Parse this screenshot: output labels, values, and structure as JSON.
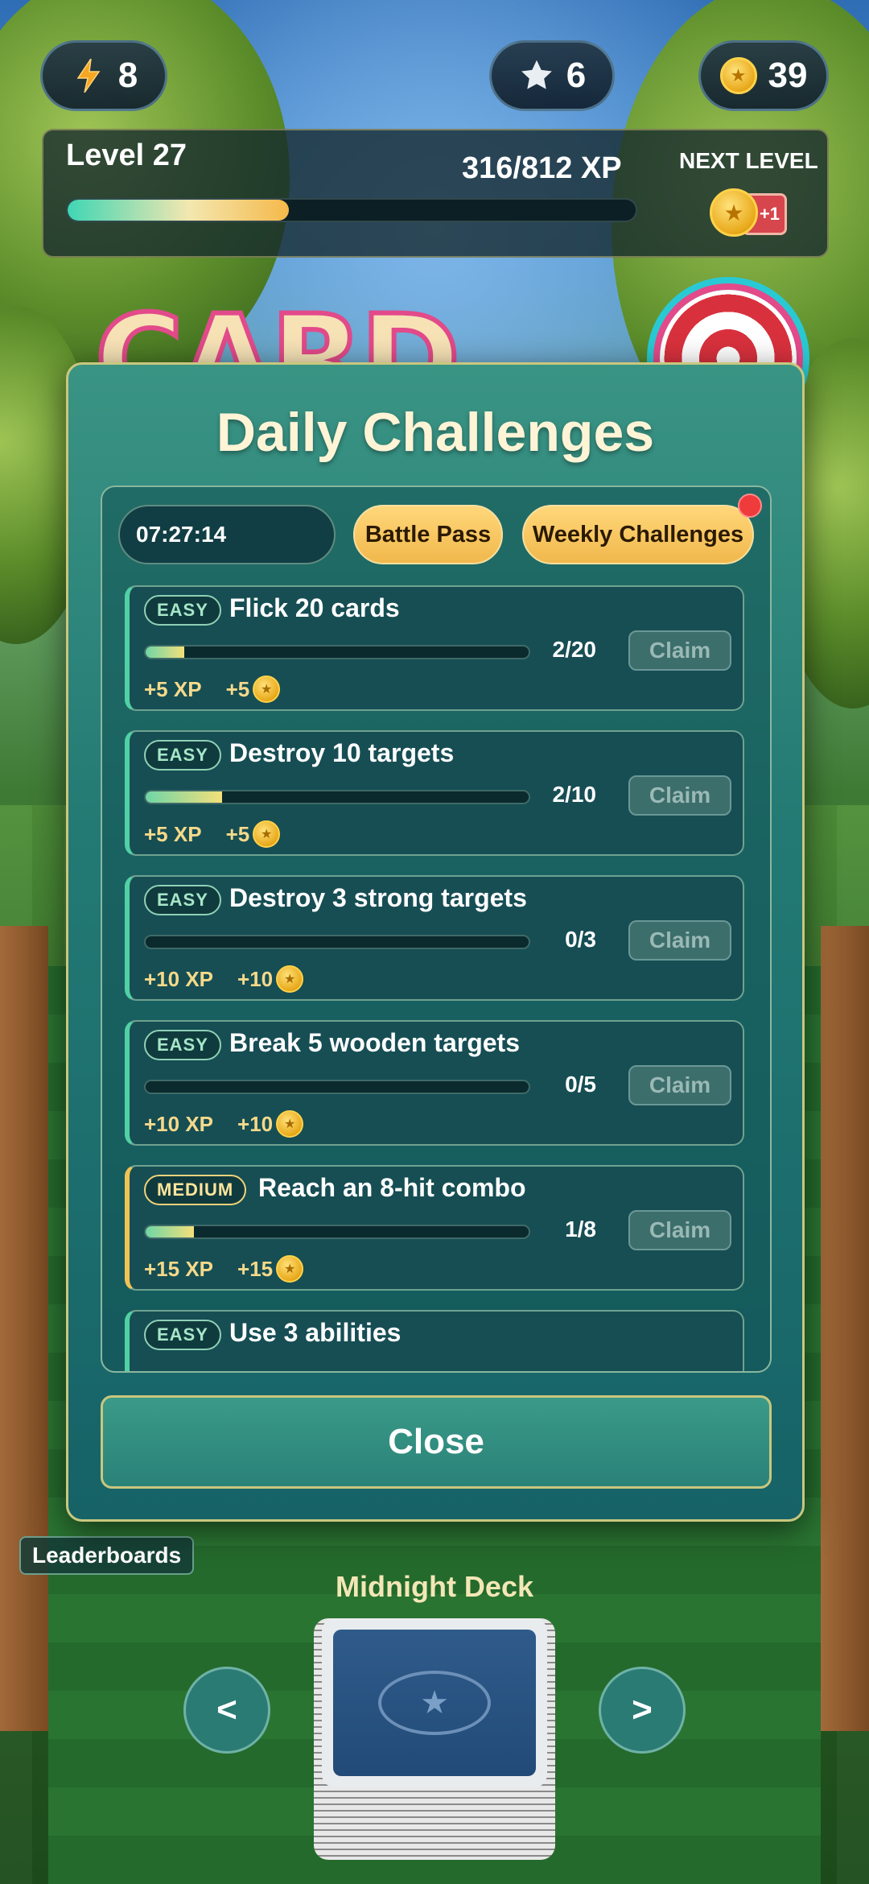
{
  "hud": {
    "energy": {
      "icon": "lightning-icon",
      "value": "8"
    },
    "stars": {
      "icon": "star-icon",
      "value": "6"
    },
    "coins": {
      "icon": "coin-icon",
      "value": "39"
    }
  },
  "level": {
    "title": "Level 27",
    "xp_text": "316/812 XP",
    "xp_progress": 0.389,
    "next_level_label": "NEXT LEVEL",
    "next_level_badge": "+1"
  },
  "background_labels": {
    "leaderboards": "Leaderboards"
  },
  "modal": {
    "title": "Daily Challenges",
    "timer": "07:27:14",
    "tabs": [
      "Battle Pass",
      "Weekly Challenges"
    ],
    "weekly_has_notification": true,
    "close_label": "Close",
    "claim_label": "Claim",
    "challenges": [
      {
        "difficulty": "EASY",
        "title": "Flick 20 cards",
        "progress": "2/20",
        "fraction": 0.1,
        "xp": "+5 XP",
        "coins": "+5"
      },
      {
        "difficulty": "EASY",
        "title": "Destroy 10 targets",
        "progress": "2/10",
        "fraction": 0.2,
        "xp": "+5 XP",
        "coins": "+5"
      },
      {
        "difficulty": "EASY",
        "title": "Destroy 3 strong targets",
        "progress": "0/3",
        "fraction": 0,
        "xp": "+10 XP",
        "coins": "+10"
      },
      {
        "difficulty": "EASY",
        "title": "Break 5 wooden targets",
        "progress": "0/5",
        "fraction": 0,
        "xp": "+10 XP",
        "coins": "+10"
      },
      {
        "difficulty": "MEDIUM",
        "title": "Reach an 8-hit combo",
        "progress": "1/8",
        "fraction": 0.125,
        "xp": "+15 XP",
        "coins": "+15"
      },
      {
        "difficulty": "EASY",
        "title": "Use 3 abilities",
        "progress": "",
        "fraction": 0,
        "xp": "",
        "coins": ""
      }
    ]
  },
  "deck": {
    "name": "Midnight Deck",
    "prev_label": "<",
    "next_label": ">"
  },
  "colors": {
    "modal_bg": "#237a74",
    "gold_tab": "#f1b84c",
    "easy_accent": "#52d0a5",
    "medium_accent": "#f0c354"
  }
}
